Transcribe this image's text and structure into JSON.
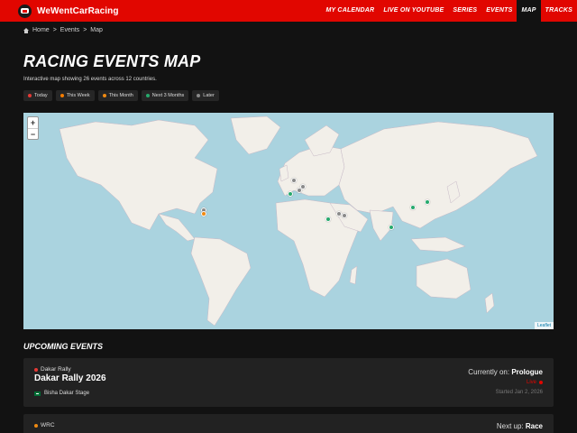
{
  "brand": {
    "name": "WeWentCarRacing"
  },
  "nav": {
    "items": [
      {
        "label": "MY CALENDAR"
      },
      {
        "label": "LIVE ON YOUTUBE"
      },
      {
        "label": "SERIES"
      },
      {
        "label": "EVENTS"
      },
      {
        "label": "MAP",
        "active": true
      },
      {
        "label": "TRACKS"
      }
    ]
  },
  "breadcrumb": {
    "home": "Home",
    "sep": ">",
    "events": "Events",
    "current": "Map"
  },
  "page": {
    "title": "RACING EVENTS MAP",
    "subtitle": "Interactive map showing 26 events across 12 countries."
  },
  "legend": [
    {
      "label": "Today",
      "color": "#e53935"
    },
    {
      "label": "This Week",
      "color": "#f57c00"
    },
    {
      "label": "This Month",
      "color": "#ef8a12"
    },
    {
      "label": "Next 3 Months",
      "color": "#26a96c"
    },
    {
      "label": "Later",
      "color": "#8a8a8a"
    }
  ],
  "map": {
    "zoom_in": "+",
    "zoom_out": "−",
    "attribution": "Leaflet",
    "colors": {
      "water": "#aad3df",
      "land": "#f2efe9",
      "border": "#c7b9c6"
    }
  },
  "upcoming": {
    "heading": "UPCOMING EVENTS",
    "events": [
      {
        "series": "Dakar Rally",
        "name": "Dakar Rally 2026",
        "stage": "Bisha Dakar Stage",
        "status_prefix": "Currently on:",
        "status_value": "Prologue",
        "live": "Live",
        "started": "Started Jan 2, 2026"
      },
      {
        "series": "WRC",
        "status_prefix": "Next up:",
        "status_value": "Race"
      }
    ]
  }
}
